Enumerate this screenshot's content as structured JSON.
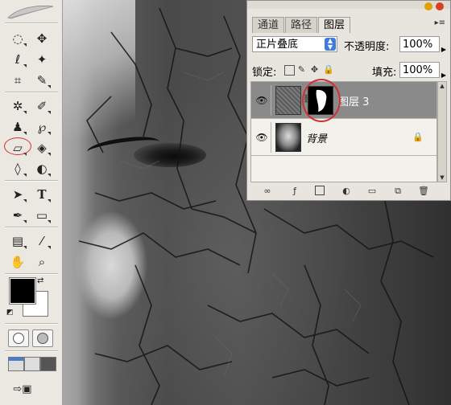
{
  "toolbox": {
    "tools": [
      {
        "name": "marquee-tool",
        "glyph": "◌"
      },
      {
        "name": "move-tool",
        "glyph": "✥"
      },
      {
        "name": "lasso-tool",
        "glyph": "ℓ"
      },
      {
        "name": "magic-wand-tool",
        "glyph": "✦"
      },
      {
        "name": "crop-tool",
        "glyph": "⌗"
      },
      {
        "name": "slice-tool",
        "glyph": "✎"
      },
      {
        "name": "healing-brush-tool",
        "glyph": "✲"
      },
      {
        "name": "brush-tool",
        "glyph": "✐"
      },
      {
        "name": "clone-stamp-tool",
        "glyph": "♟"
      },
      {
        "name": "history-brush-tool",
        "glyph": "℘"
      },
      {
        "name": "eraser-tool",
        "glyph": "▱"
      },
      {
        "name": "paint-bucket-tool",
        "glyph": "◈"
      },
      {
        "name": "blur-tool",
        "glyph": "◊"
      },
      {
        "name": "dodge-tool",
        "glyph": "◐"
      },
      {
        "name": "path-selection-tool",
        "glyph": "➤"
      },
      {
        "name": "type-tool",
        "glyph": "T"
      },
      {
        "name": "pen-tool",
        "glyph": "✒"
      },
      {
        "name": "rectangle-tool",
        "glyph": "▭"
      },
      {
        "name": "notes-tool",
        "glyph": "▤"
      },
      {
        "name": "eyedropper-tool",
        "glyph": "⁄"
      },
      {
        "name": "hand-tool",
        "glyph": "✋"
      },
      {
        "name": "zoom-tool",
        "glyph": "⌕"
      }
    ],
    "foreground_color": "#000000",
    "background_color": "#ffffff"
  },
  "layers_panel": {
    "tabs": [
      {
        "label": "通道",
        "active": false
      },
      {
        "label": "路径",
        "active": false
      },
      {
        "label": "图层",
        "active": true
      }
    ],
    "blend_mode": "正片叠底",
    "opacity_label": "不透明度:",
    "opacity_value": "100%",
    "lock_label": "锁定:",
    "fill_label": "填充:",
    "fill_value": "100%",
    "layers": [
      {
        "name": "图层 3",
        "selected": true,
        "visible": true,
        "has_mask": true
      },
      {
        "name": "背景",
        "selected": false,
        "visible": true,
        "locked": true
      }
    ]
  },
  "colors": {
    "highlight_circle": "#d13030",
    "selected_layer": "#8a8a8a",
    "panel_bg": "#e8e5de"
  }
}
